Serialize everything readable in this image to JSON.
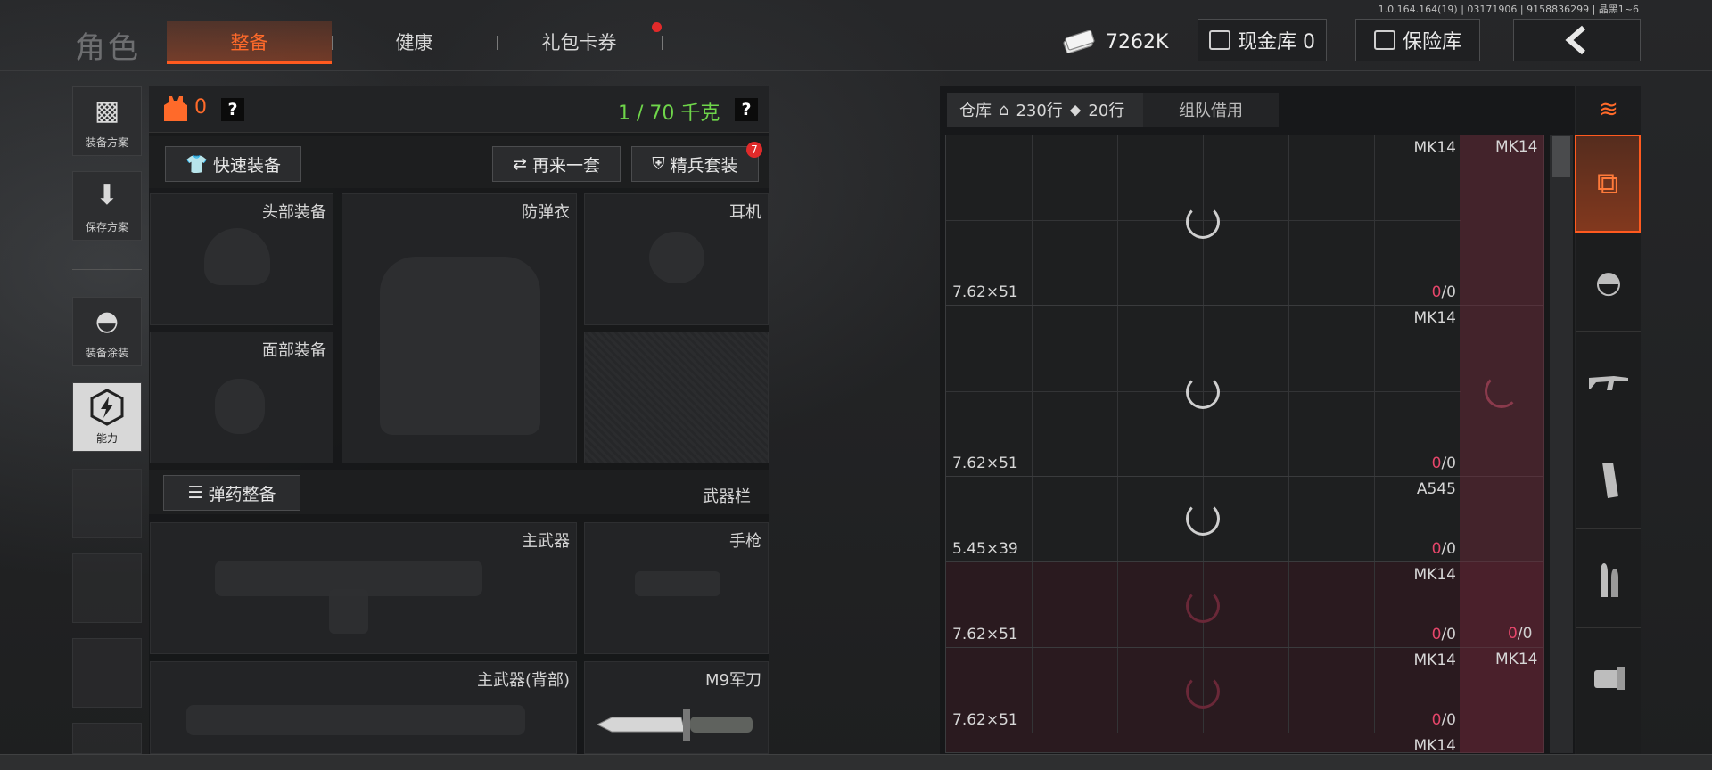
{
  "version_text": "1.0.164.164(19) | 03171906 | 9158836299 | 晶黑1~6",
  "header": {
    "title": "角色",
    "tabs": [
      {
        "label": "整备",
        "active": true
      },
      {
        "label": "健康",
        "active": false
      },
      {
        "label": "礼包卡券",
        "active": false,
        "badge_dot": true
      }
    ],
    "money_value": "7262K",
    "cash_vault_label": "现金库 0",
    "safe_vault_label": "保险库",
    "back_icon": "chevron-left-icon"
  },
  "sidebar": {
    "items": [
      {
        "label": "装备方案",
        "icon": "vest-icon"
      },
      {
        "label": "保存方案",
        "icon": "download-icon"
      },
      {
        "label": "装备涂装",
        "icon": "helmet-paint-icon"
      },
      {
        "label": "能力",
        "icon": "lightning-hexagon-icon",
        "selected": true
      }
    ]
  },
  "loadout": {
    "armor_count": "0",
    "weight_text": "1 / 70 千克",
    "help_icon": "?",
    "quick_equip_label": "快速装备",
    "repeat_set_label": "再来一套",
    "elite_set_label": "精兵套装",
    "elite_badge": "7",
    "slots": {
      "head": "头部装备",
      "armor": "防弹衣",
      "headset": "耳机",
      "face": "面部装备"
    },
    "ammo_equip_label": "弹药整备",
    "weapon_bar_label": "武器栏",
    "weapons": {
      "primary": "主武器",
      "pistol": "手枪",
      "primary_back": "主武器(背部)",
      "melee": "M9军刀"
    }
  },
  "warehouse": {
    "tab_label": "仓库",
    "rows_label": "230行",
    "rows2_label": "20行",
    "team_borrow_label": "组队借用",
    "items": [
      {
        "name": "MK14",
        "caliber": "7.62×51",
        "count_a": "0",
        "count_b": "0",
        "red": false
      },
      {
        "name": "MK14",
        "caliber": "7.62×51",
        "count_a": "0",
        "count_b": "0",
        "red": false
      },
      {
        "name": "A545",
        "caliber": "5.45×39",
        "count_a": "0",
        "count_b": "0",
        "red": false
      },
      {
        "name": "MK14",
        "caliber": "7.62×51",
        "count_a": "0",
        "count_b": "0",
        "red": true
      },
      {
        "name": "MK14",
        "caliber": "7.62×51",
        "count_a": "0",
        "count_b": "0",
        "red": true
      },
      {
        "name": "MK14",
        "caliber": "",
        "count_a": "",
        "count_b": "",
        "red": true
      }
    ],
    "right_col": {
      "top_name": "MK14",
      "row4_count_a": "0",
      "row4_count_b": "0",
      "row5_name": "MK14"
    }
  },
  "filter_rail": [
    "layers-refresh-icon",
    "stack-icon",
    "helmet-icon",
    "rifle-icon",
    "magazine-icon",
    "bullets-icon",
    "scope-icon"
  ]
}
